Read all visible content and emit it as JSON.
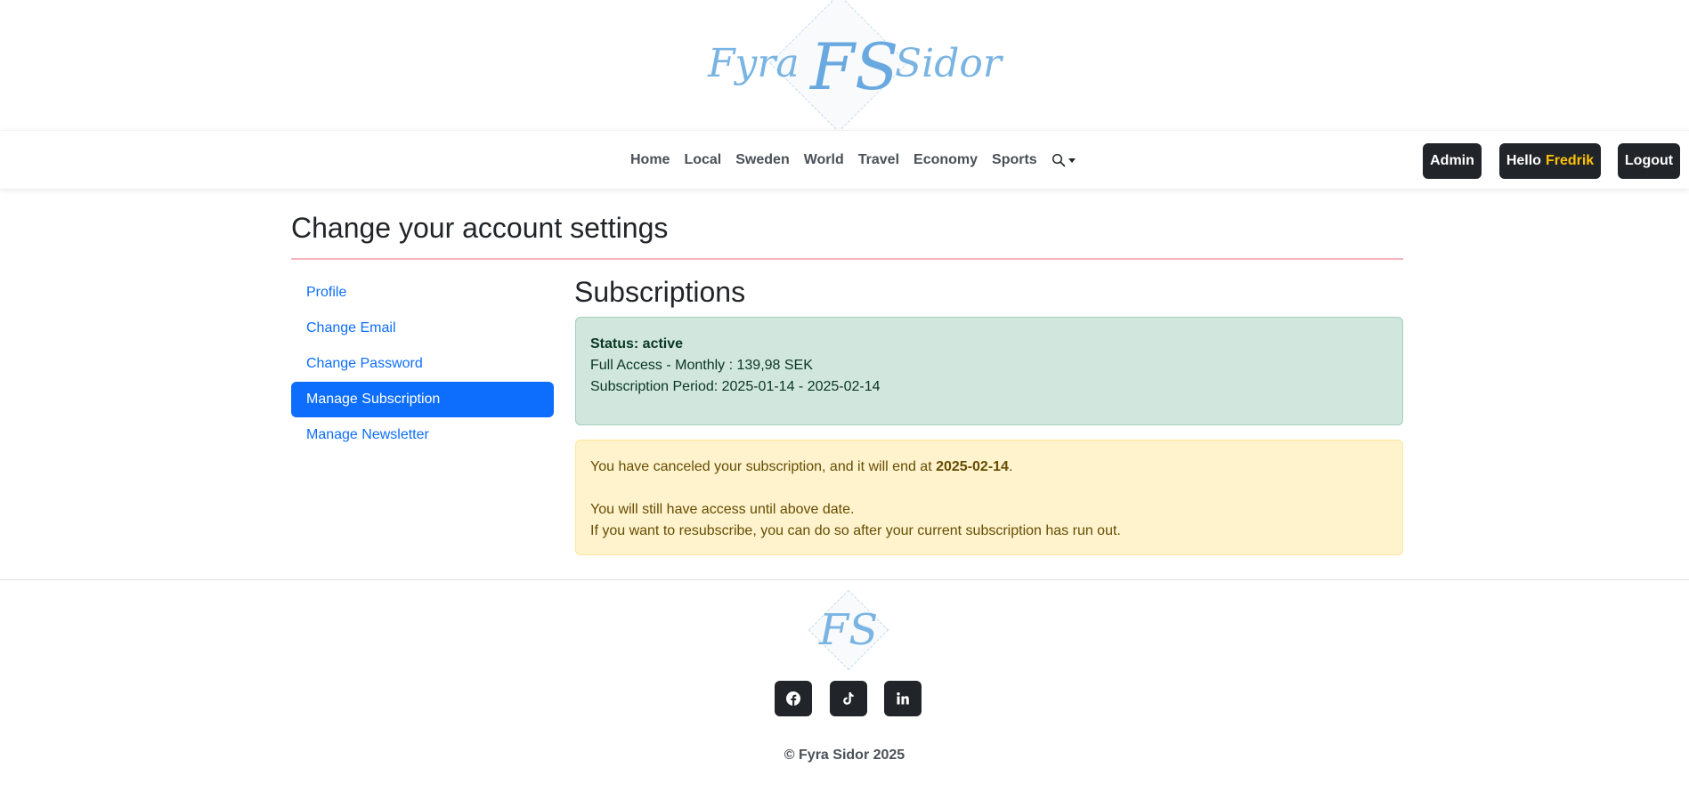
{
  "brand": {
    "left_word": "Fyra",
    "right_word": "Sidor",
    "monogram": "FS"
  },
  "nav": {
    "links": [
      "Home",
      "Local",
      "Sweden",
      "World",
      "Travel",
      "Economy",
      "Sports"
    ],
    "admin_label": "Admin",
    "hello_label": "Hello",
    "username": "Fredrik",
    "logout_label": "Logout"
  },
  "page": {
    "title": "Change your account settings"
  },
  "sidebar": {
    "items": [
      {
        "label": "Profile"
      },
      {
        "label": "Change Email"
      },
      {
        "label": "Change Password"
      },
      {
        "label": "Manage Subscription"
      },
      {
        "label": "Manage Newsletter"
      }
    ]
  },
  "subscriptions": {
    "title": "Subscriptions",
    "status": "Status: active",
    "plan": "Full Access - Monthly : 139,98 SEK",
    "period": "Subscription Period: 2025-01-14 - 2025-02-14",
    "cancel_prefix": "You have canceled your subscription, and it will end at",
    "cancel_date": "2025-02-14",
    "cancel_suffix": ".",
    "access_note": "You will still have access until above date.",
    "resubscribe_note": "If you want to resubscribe, you can do so after your current subscription has run out."
  },
  "footer": {
    "copyright": "© Fyra Sidor 2025"
  },
  "colors": {
    "accent": "#0d6efd",
    "dark": "#212529",
    "username": "#ffc107",
    "logo": "#7ab4e3",
    "success_bg": "#d1e7dd",
    "warning_bg": "#fff3cd"
  }
}
